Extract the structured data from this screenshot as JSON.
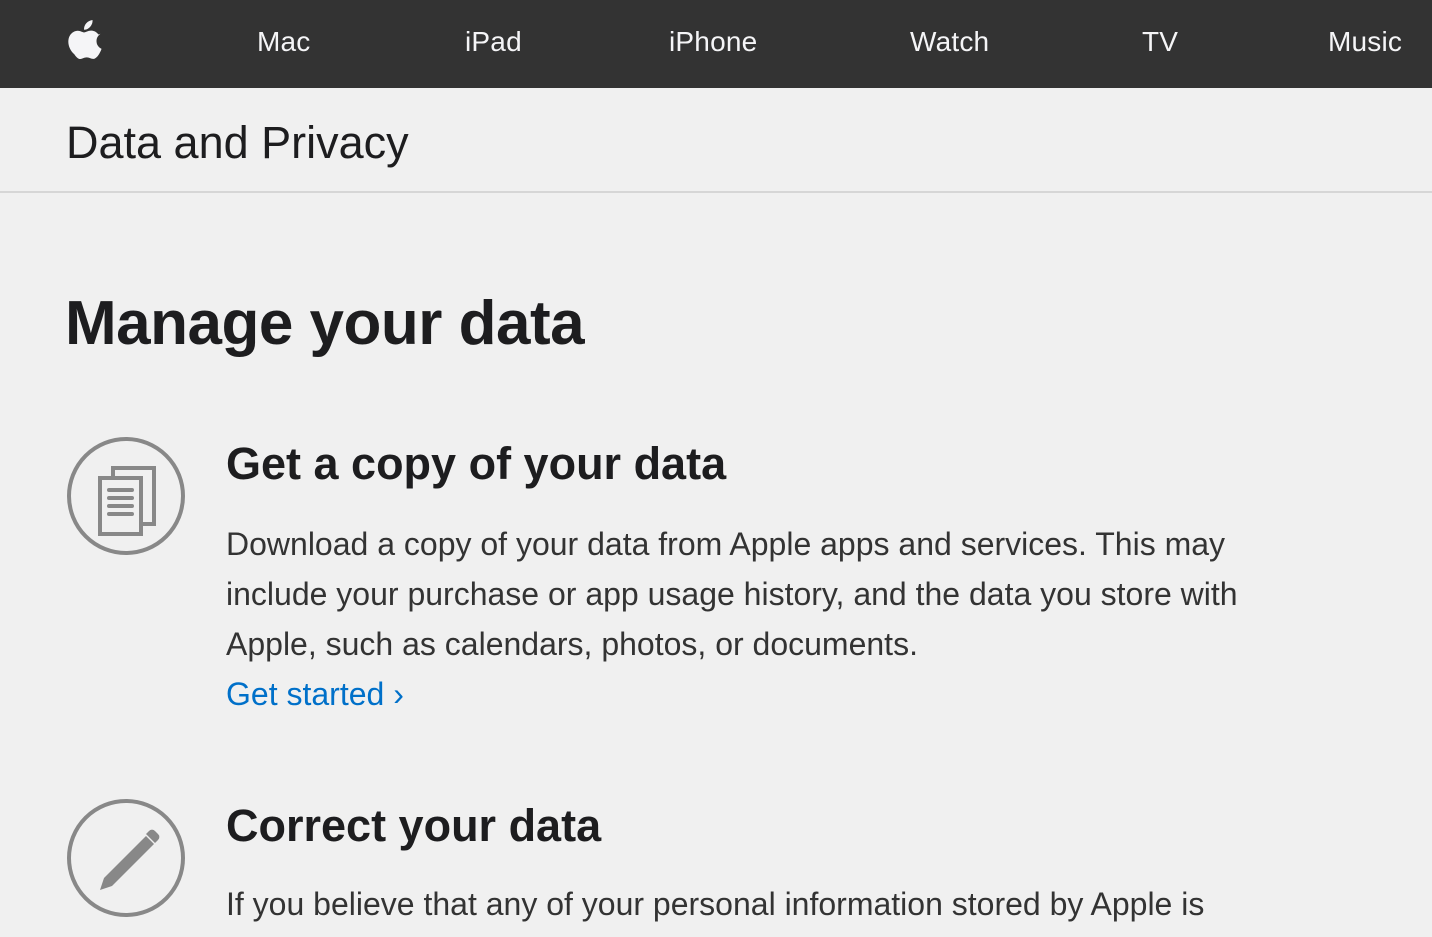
{
  "globalnav": {
    "logo_icon": "apple-logo-icon",
    "items": [
      {
        "label": "Mac"
      },
      {
        "label": "iPad"
      },
      {
        "label": "iPhone"
      },
      {
        "label": "Watch"
      },
      {
        "label": "TV"
      },
      {
        "label": "Music"
      }
    ]
  },
  "localnav": {
    "title": "Data and Privacy"
  },
  "main": {
    "heading": "Manage your data",
    "sections": [
      {
        "icon": "documents-icon",
        "title": "Get a copy of your data",
        "body": "Download a copy of your data from Apple apps and services. This may include your purchase or app usage history, and the data you store with Apple, such as calendars, photos, or documents.",
        "link_label": "Get started ›"
      },
      {
        "icon": "pencil-icon",
        "title": "Correct your data",
        "body": "If you believe that any of your personal information stored by Apple is"
      }
    ]
  },
  "colors": {
    "nav_background": "#333333",
    "page_background": "#f0f0f0",
    "link": "#0070c9",
    "icon_gray": "#888888"
  }
}
